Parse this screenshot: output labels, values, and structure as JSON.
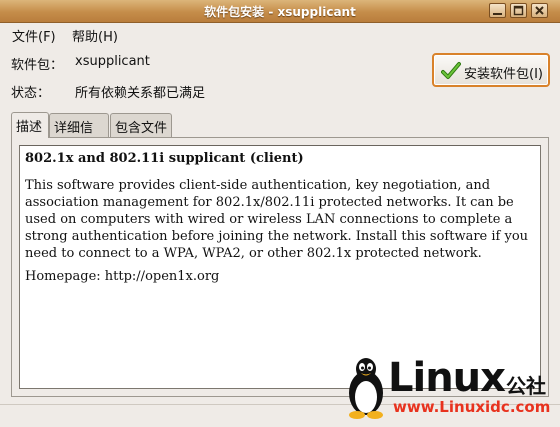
{
  "window": {
    "title": "软件包安装 - xsupplicant"
  },
  "menu": {
    "file": "文件(F)",
    "help": "帮助(H)"
  },
  "info": {
    "package_label": "软件包：",
    "package_value": "xsupplicant",
    "status_label": "状态：",
    "status_value": "所有依赖关系都已满足"
  },
  "install_button": {
    "label": "安装软件包(I)",
    "icon": "check-icon"
  },
  "tabs": [
    {
      "label": "描述"
    },
    {
      "label": "详细信息"
    },
    {
      "label": "包含文件"
    }
  ],
  "description": {
    "title": "802.1x and 802.11i supplicant (client)",
    "body": "This software provides client-side authentication, key negotiation, and association management for 802.1x/802.11i protected networks. It can be used on computers with wired or wireless LAN connections to complete a strong authentication before joining the network. Install this software if you need to connect to a WPA, WPA2, or other 802.1x protected network.",
    "homepage": "Homepage: http://open1x.org"
  },
  "watermark": {
    "brand": "Linux",
    "suffix": "公社",
    "url": "www.Linuxidc.com"
  },
  "colors": {
    "titlebar": "#c58d4a",
    "window_bg": "#efebe7",
    "focus_orange": "#d9822b",
    "check_green": "#3f9a1c",
    "watermark_red": "#e8321e"
  }
}
